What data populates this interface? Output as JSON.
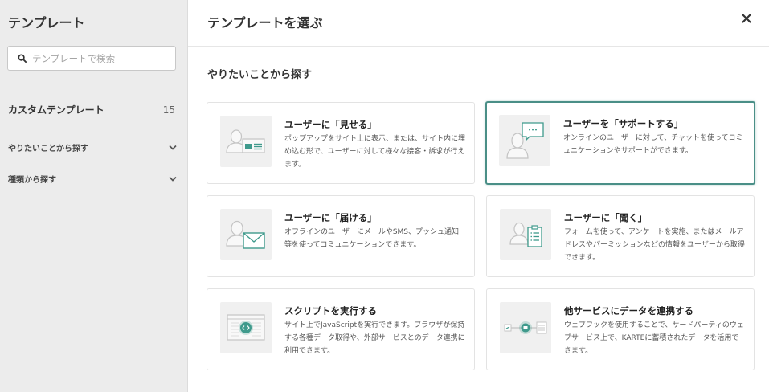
{
  "sidebar": {
    "title": "テンプレート",
    "search_placeholder": "テンプレートで検索",
    "custom_label": "カスタムテンプレート",
    "custom_count": "15",
    "filters": [
      {
        "label": "やりたいことから探す"
      },
      {
        "label": "種類から探す"
      }
    ]
  },
  "modal": {
    "title": "テンプレートを選ぶ",
    "section_title": "やりたいことから探す"
  },
  "cards": [
    {
      "title": "ユーザーに「見せる」",
      "desc": "ポップアップをサイト上に表示、または、サイト内に埋め込む形で、ユーザーに対して様々な接客・訴求が行えます。",
      "icon": "person-display-icon",
      "selected": false
    },
    {
      "title": "ユーザーを「サポートする」",
      "desc": "オンラインのユーザーに対して、チャットを使ってコミュニケーションやサポートができます。",
      "icon": "person-chat-icon",
      "selected": true
    },
    {
      "title": "ユーザーに「届ける」",
      "desc": "オフラインのユーザーにメールやSMS、プッシュ通知等を使ってコミュニケーションできます。",
      "icon": "person-mail-icon",
      "selected": false
    },
    {
      "title": "ユーザーに「聞く」",
      "desc": "フォームを使って、アンケートを実施、またはメールアドレスやパーミッションなどの情報をユーザーから取得できます。",
      "icon": "person-survey-icon",
      "selected": false
    },
    {
      "title": "スクリプトを実行する",
      "desc": "サイト上でJavaScriptを実行できます。ブラウザが保持する各種データ取得や、外部サービスとのデータ連携に利用できます。",
      "icon": "script-code-icon",
      "selected": false
    },
    {
      "title": "他サービスにデータを連携する",
      "desc": "ウェブフックを使用することで、サードパーティのウェブサービス上で、KARTEに蓄積されたデータを活用できます。",
      "icon": "data-link-icon",
      "selected": false
    }
  ],
  "colors": {
    "accent": "#4a8f87",
    "icon_teal": "#3f9a8c",
    "sidebar_bg": "#ececec"
  }
}
